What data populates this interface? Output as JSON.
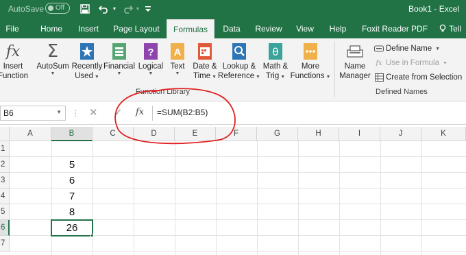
{
  "title_bar": {
    "autosave_label": "AutoSave",
    "autosave_state": "Off",
    "save_icon": "save-icon",
    "undo_icon": "undo-icon",
    "redo_icon": "redo-icon",
    "customize_icon": "customize-qat-icon",
    "title": "Book1  -  Excel",
    "bar_color": "#217346"
  },
  "tabs": [
    "File",
    "Home",
    "Insert",
    "Page Layout",
    "Formulas",
    "Data",
    "Review",
    "View",
    "Help",
    "Foxit Reader PDF"
  ],
  "active_tab": "Formulas",
  "tell_me": "Tell",
  "ribbon": {
    "insert_function": {
      "line1": "Insert",
      "line2": "Function",
      "icon": "fx-icon"
    },
    "function_library_buttons": [
      {
        "line1": "AutoSum",
        "icon": "sigma-icon",
        "caret": true
      },
      {
        "line1": "Recently",
        "line2": "Used",
        "icon": "star-book-icon",
        "caret": true
      },
      {
        "line1": "Financial",
        "icon": "financial-book-icon",
        "caret": true
      },
      {
        "line1": "Logical",
        "icon": "logical-book-icon",
        "caret": true
      },
      {
        "line1": "Text",
        "icon": "text-book-icon",
        "caret": true
      },
      {
        "line1": "Date &",
        "line2": "Time",
        "icon": "calendar-book-icon",
        "caret": true
      },
      {
        "line1": "Lookup &",
        "line2": "Reference",
        "icon": "lookup-book-icon",
        "caret": true
      },
      {
        "line1": "Math &",
        "line2": "Trig",
        "icon": "theta-book-icon",
        "caret": true
      },
      {
        "line1": "More",
        "line2": "Functions",
        "icon": "more-functions-icon",
        "caret": true
      }
    ],
    "function_library_label": "Function Library",
    "name_manager": {
      "line1": "Name",
      "line2": "Manager",
      "icon": "name-manager-icon"
    },
    "define_name": "Define Name",
    "use_in_formula": "Use in Formula",
    "create_from_selection": "Create from Selection",
    "defined_names_label": "Defined Names"
  },
  "formula_bar": {
    "name_box": "B6",
    "cancel_symbol": "✕",
    "enter_symbol": "✓",
    "fx_symbol": "fx",
    "formula": "=SUM(B2:B5)"
  },
  "grid": {
    "columns": [
      "A",
      "B",
      "C",
      "D",
      "E",
      "F",
      "G",
      "H",
      "I",
      "J",
      "K"
    ],
    "rows": [
      "1",
      "2",
      "3",
      "4",
      "5",
      "6",
      "7"
    ],
    "selected_column": "B",
    "selected_row": "6",
    "cells": {
      "B2": "5",
      "B3": "6",
      "B4": "7",
      "B5": "8",
      "B6": "26"
    }
  },
  "annotation_color": "#e02020"
}
